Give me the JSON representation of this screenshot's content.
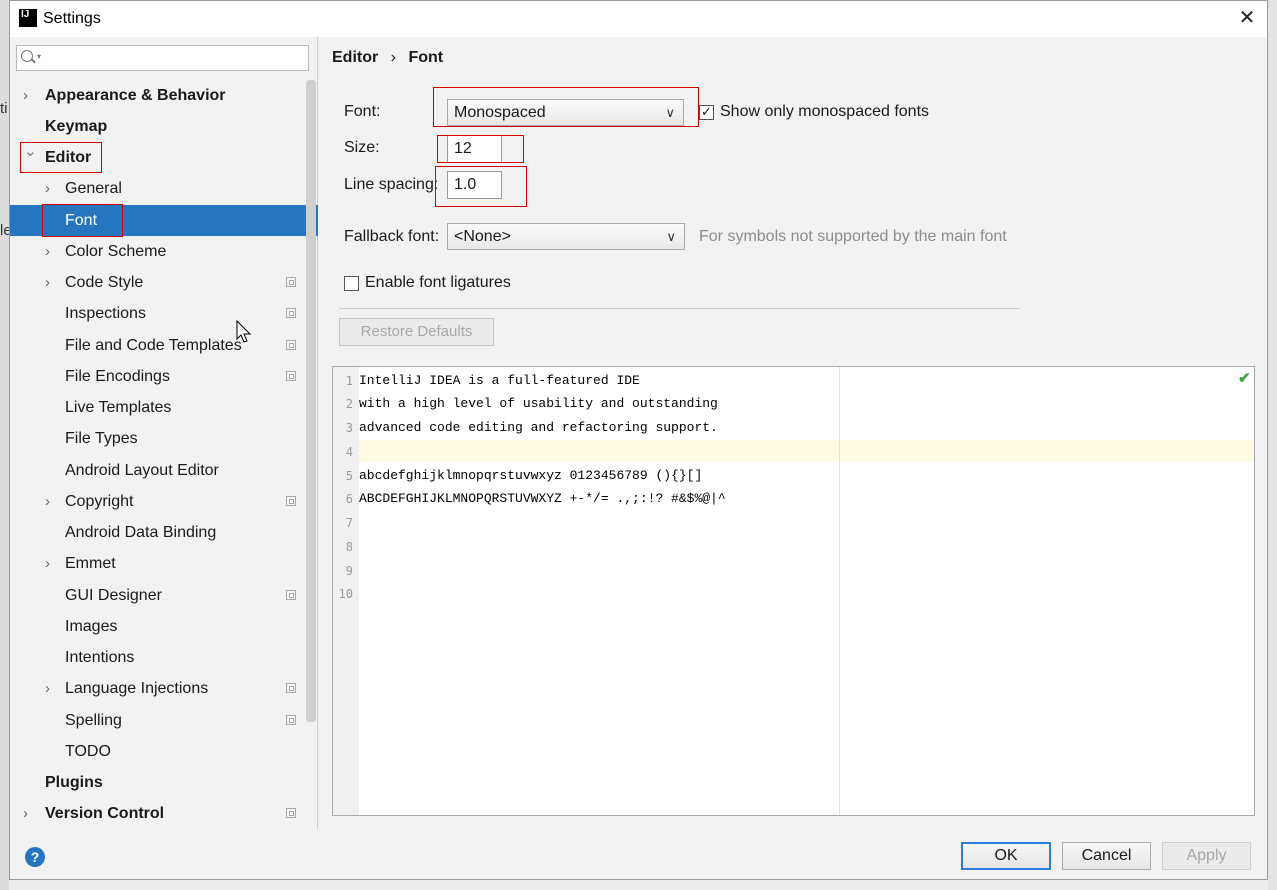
{
  "window": {
    "title": "Settings"
  },
  "search": {
    "placeholder": ""
  },
  "sidebar": {
    "items": [
      {
        "label": "Appearance & Behavior"
      },
      {
        "label": "Keymap"
      },
      {
        "label": "Editor"
      },
      {
        "label": "General"
      },
      {
        "label": "Font"
      },
      {
        "label": "Color Scheme"
      },
      {
        "label": "Code Style"
      },
      {
        "label": "Inspections"
      },
      {
        "label": "File and Code Templates"
      },
      {
        "label": "File Encodings"
      },
      {
        "label": "Live Templates"
      },
      {
        "label": "File Types"
      },
      {
        "label": "Android Layout Editor"
      },
      {
        "label": "Copyright"
      },
      {
        "label": "Android Data Binding"
      },
      {
        "label": "Emmet"
      },
      {
        "label": "GUI Designer"
      },
      {
        "label": "Images"
      },
      {
        "label": "Intentions"
      },
      {
        "label": "Language Injections"
      },
      {
        "label": "Spelling"
      },
      {
        "label": "TODO"
      },
      {
        "label": "Plugins"
      },
      {
        "label": "Version Control"
      }
    ]
  },
  "breadcrumb": {
    "parent": "Editor",
    "separator": "›",
    "current": "Font"
  },
  "font_settings": {
    "font_label": "Font:",
    "font_value": "Monospaced",
    "show_mono_label": "Show only monospaced fonts",
    "show_mono_checked": true,
    "size_label": "Size:",
    "size_value": "12",
    "line_spacing_label": "Line spacing:",
    "line_spacing_value": "1.0",
    "fallback_label": "Fallback font:",
    "fallback_value": "<None>",
    "fallback_hint": "For symbols not supported by the main font",
    "ligatures_label": "Enable font ligatures",
    "ligatures_checked": false,
    "restore_label": "Restore Defaults"
  },
  "preview": {
    "line_numbers": [
      "1",
      "2",
      "3",
      "4",
      "5",
      "6",
      "7",
      "8",
      "9",
      "10"
    ],
    "lines": [
      "IntelliJ IDEA is a full-featured IDE",
      "with a high level of usability and outstanding",
      "advanced code editing and refactoring support.",
      "",
      "abcdefghijklmnopqrstuvwxyz 0123456789 (){}[]",
      "ABCDEFGHIJKLMNOPQRSTUVWXYZ +-*/= .,;:!? #&$%@|^",
      "",
      "",
      "",
      ""
    ]
  },
  "footer": {
    "help": "?",
    "ok": "OK",
    "cancel": "Cancel",
    "apply": "Apply"
  },
  "background_fragments": {
    "left_1": "ti",
    "left_2": "le"
  },
  "colors": {
    "selection": "#2675bf",
    "annotation_red": "#d40000",
    "ok_border": "#2b7de0"
  }
}
